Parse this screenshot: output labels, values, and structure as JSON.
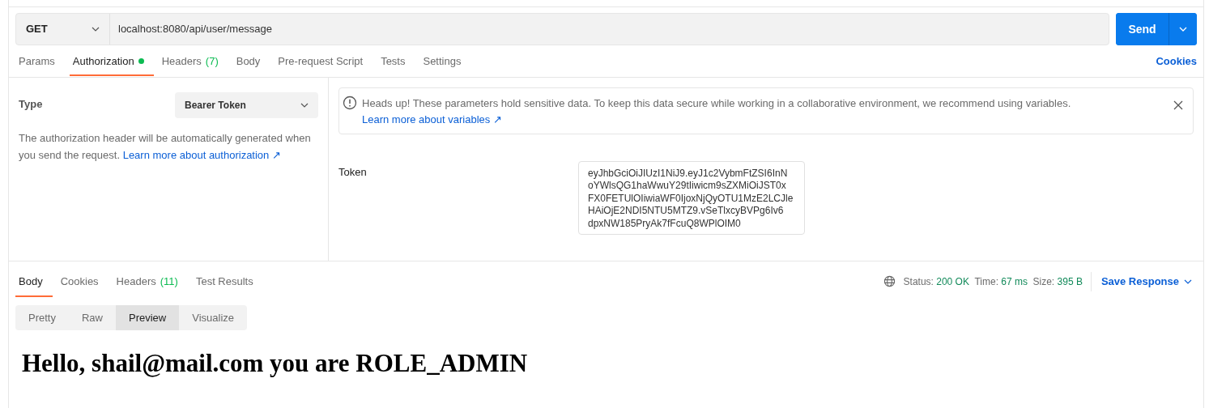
{
  "request": {
    "method": "GET",
    "url": "localhost:8080/api/user/message",
    "send_label": "Send"
  },
  "request_tabs": [
    {
      "label": "Params",
      "selected": false
    },
    {
      "label": "Authorization",
      "selected": true,
      "dot": true
    },
    {
      "label": "Headers",
      "count": "(7)",
      "selected": false
    },
    {
      "label": "Body",
      "selected": false
    },
    {
      "label": "Pre-request Script",
      "selected": false
    },
    {
      "label": "Tests",
      "selected": false
    },
    {
      "label": "Settings",
      "selected": false
    }
  ],
  "cookies_link": "Cookies",
  "auth": {
    "type_label": "Type",
    "type_value": "Bearer Token",
    "description": "The authorization header will be automatically generated when you send the request. ",
    "link": "Learn more about authorization ↗"
  },
  "alert": {
    "text": "Heads up! These parameters hold sensitive data. To keep this data secure while working in a collaborative environment, we recommend using variables.",
    "link": "Learn more about variables ↗"
  },
  "token": {
    "label": "Token",
    "lines": [
      "eyJhbGciOiJIUzI1NiJ9.eyJ1c2VybmFtZSI6InN",
      "oYWlsQG1haWwuY29tIiwicm9sZXMiOiJST0x",
      "FX0FETUlOIiwiaWF0IjoxNjQyOTU1MzE2LCJle",
      "HAiOjE2NDI5NTU5MTZ9.vSeTlxcyBVPg6Iv6",
      "dpxNW185PryAk7fFcuQ8WPlOIM0"
    ]
  },
  "response_tabs": [
    {
      "label": "Body",
      "selected": true
    },
    {
      "label": "Cookies",
      "selected": false
    },
    {
      "label": "Headers",
      "count": "(11)",
      "selected": false
    },
    {
      "label": "Test Results",
      "selected": false
    }
  ],
  "response_meta": [
    {
      "label": "Status:",
      "value": "200 OK"
    },
    {
      "label": "Time:",
      "value": "67 ms"
    },
    {
      "label": "Size:",
      "value": "395 B"
    }
  ],
  "save_response": "Save Response",
  "views": [
    {
      "label": "Pretty",
      "selected": false
    },
    {
      "label": "Raw",
      "selected": false
    },
    {
      "label": "Preview",
      "selected": true
    },
    {
      "label": "Visualize",
      "selected": false
    }
  ],
  "body_heading": "Hello, shail@mail.com you are ROLE_ADMIN"
}
